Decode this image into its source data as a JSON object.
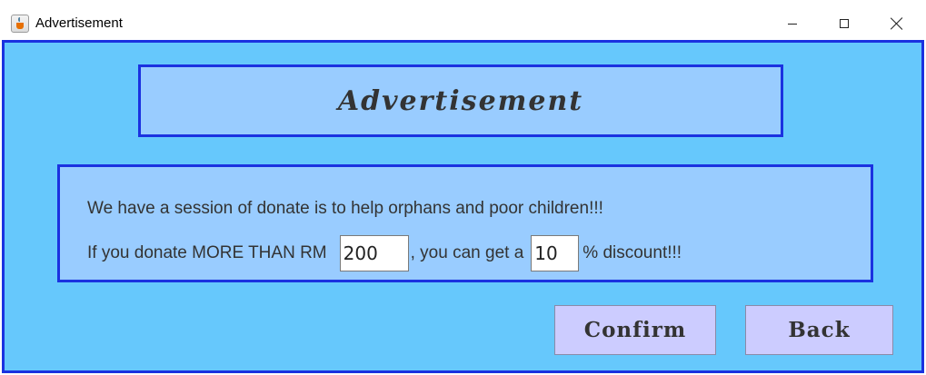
{
  "window": {
    "title": "Advertisement",
    "icon": "java-app-icon",
    "controls": [
      "minimize",
      "maximize",
      "close"
    ]
  },
  "header": {
    "title": "Advertisement"
  },
  "message": {
    "line1": "We have a session of donate is to help orphans and poor children!!!",
    "line2_prefix": "If you donate MORE THAN RM",
    "amount_value": "200",
    "line2_middle": ", you can get a",
    "discount_value": "10",
    "line2_suffix": "% discount!!!"
  },
  "buttons": {
    "confirm": "Confirm",
    "back": "Back"
  },
  "colors": {
    "background": "#66c8fc",
    "panel": "#99ccff",
    "border": "#1b32e0",
    "button": "#ccccff",
    "text": "#333333"
  }
}
